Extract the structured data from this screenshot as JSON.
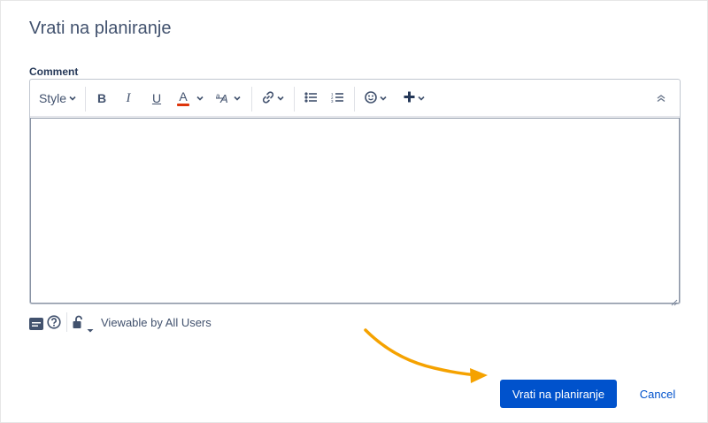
{
  "dialog": {
    "title": "Vrati na planiranje",
    "comment_label": "Comment"
  },
  "toolbar": {
    "style_label": "Style",
    "bold_label": "B",
    "italic_label": "I",
    "underline_label": "U",
    "text_color_label": "A",
    "text_color_accent": "#de350b",
    "icons": [
      "bold-icon",
      "italic-icon",
      "underline-icon",
      "text-color-icon",
      "text-effects-icon",
      "link-icon",
      "bullet-list-icon",
      "numbered-list-icon",
      "emoji-icon",
      "plus-icon",
      "collapse-icon"
    ]
  },
  "editor": {
    "value": ""
  },
  "restrictions": {
    "visibility_text": "Viewable by All Users"
  },
  "actions": {
    "submit_label": "Vrati na planiranje",
    "cancel_label": "Cancel"
  },
  "colors": {
    "primary": "#0052cc",
    "annotation_arrow": "#f5a200"
  }
}
